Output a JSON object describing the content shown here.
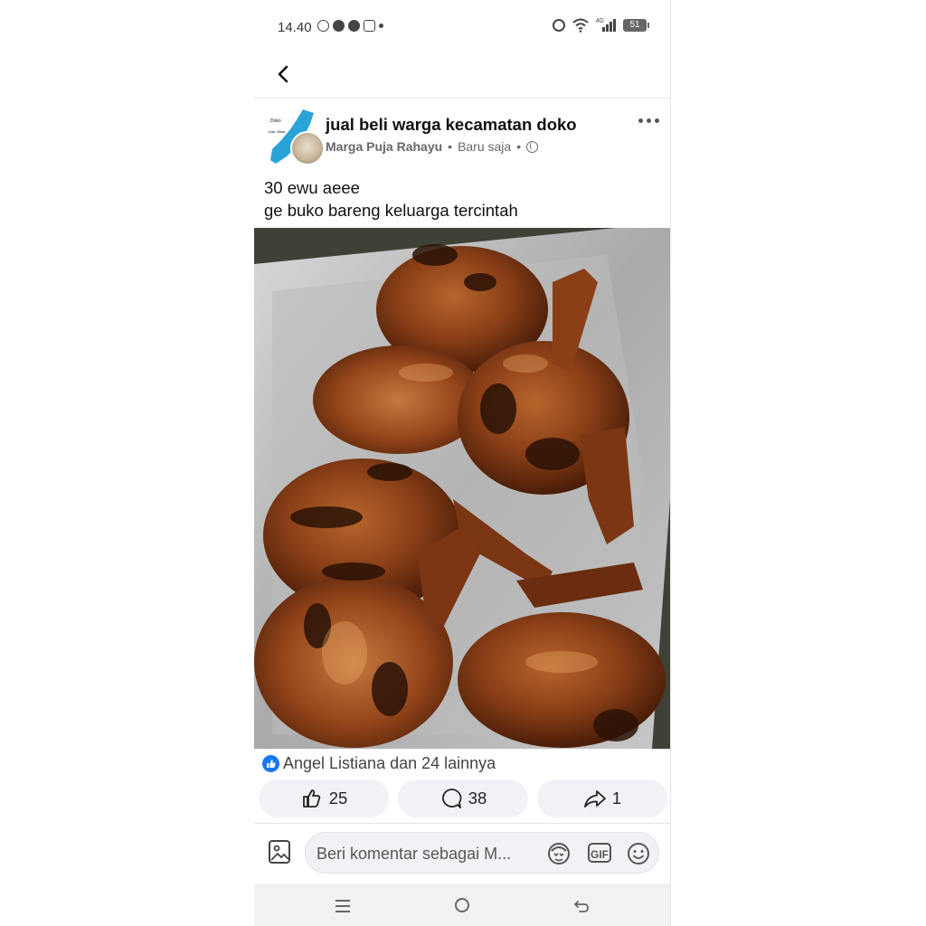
{
  "status_bar": {
    "time": "14.40",
    "network": "4G",
    "battery": "51"
  },
  "post": {
    "group_name": "jual beli warga kecamatan doko",
    "author": "Marga Puja Rahayu",
    "timestamp": "Baru saja",
    "separator": "•",
    "text_line1": "30 ewu aeee",
    "text_line2": "ge buko bareng keluarga tercintah",
    "group_map_labels": [
      "Doko",
      "Kab. Blitar"
    ],
    "photo_icon": "grilled-chicken-photo"
  },
  "engagement": {
    "reactions_text": "Angel Listiana dan 24 lainnya",
    "like_count": "25",
    "comment_count": "38",
    "share_count": "1"
  },
  "comment_bar": {
    "placeholder": "Beri komentar sebagai M...",
    "gif_label": "GIF"
  },
  "colors": {
    "accent": "#1877f2",
    "action_bg": "#f0f2f5",
    "meta_text": "#65676b"
  }
}
